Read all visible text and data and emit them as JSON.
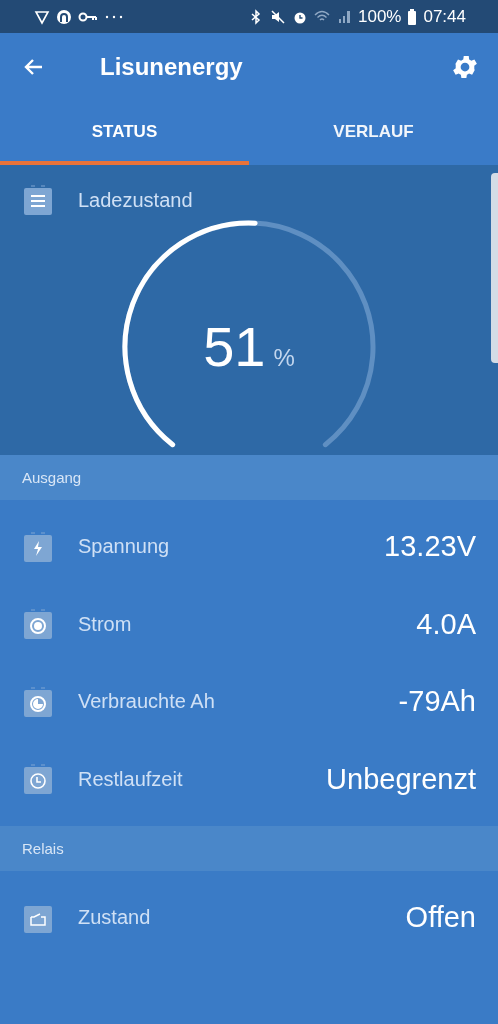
{
  "status_bar": {
    "battery": "100%",
    "time": "07:44"
  },
  "app_bar": {
    "title": "Lisunenergy"
  },
  "tabs": [
    {
      "label": "STATUS",
      "selected": true
    },
    {
      "label": "VERLAUF",
      "selected": false
    }
  ],
  "gauge": {
    "label": "Ladezustand",
    "value": "51",
    "unit": "%"
  },
  "sections": [
    {
      "title": "Ausgang",
      "rows": [
        {
          "kind": "bolt",
          "label": "Spannung",
          "value": "13.23V"
        },
        {
          "kind": "dot",
          "label": "Strom",
          "value": "4.0A"
        },
        {
          "kind": "pie",
          "label": "Verbrauchte Ah",
          "value": "-79Ah"
        },
        {
          "kind": "clock",
          "label": "Restlaufzeit",
          "value": "Unbegrenzt"
        }
      ]
    },
    {
      "title": "Relais",
      "rows": [
        {
          "kind": "relay",
          "label": "Zustand",
          "value": "Offen"
        }
      ]
    }
  ]
}
